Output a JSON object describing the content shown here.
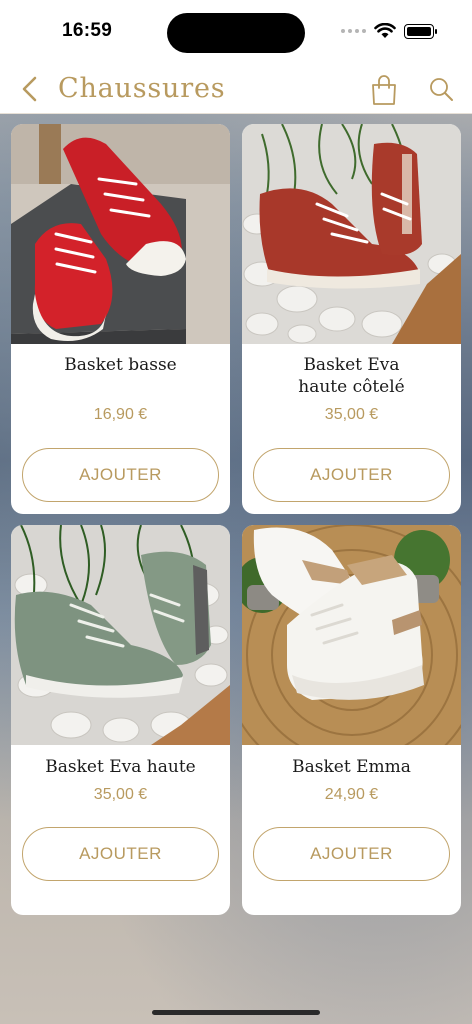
{
  "status": {
    "time": "16:59"
  },
  "nav": {
    "title": "Chaussures",
    "back_icon": "chevron-left-icon",
    "bag_icon": "shopping-bag-icon",
    "search_icon": "search-icon",
    "accent_color": "#b89a5f"
  },
  "products": [
    {
      "name_line1": "Basket basse",
      "name_line2": "",
      "price": "16,90 €",
      "button": "AJOUTER",
      "image": "red-low-top-sneakers"
    },
    {
      "name_line1": "Basket Eva",
      "name_line2": "haute côtelé",
      "price": "35,00 €",
      "button": "AJOUTER",
      "image": "rust-high-top-sneakers"
    },
    {
      "name_line1": "Basket Eva haute",
      "name_line2": "",
      "price": "35,00 €",
      "button": "AJOUTER",
      "image": "sage-high-top-sneakers"
    },
    {
      "name_line1": "Basket Emma",
      "name_line2": "",
      "price": "24,90 €",
      "button": "AJOUTER",
      "image": "white-beige-sneakers"
    }
  ]
}
